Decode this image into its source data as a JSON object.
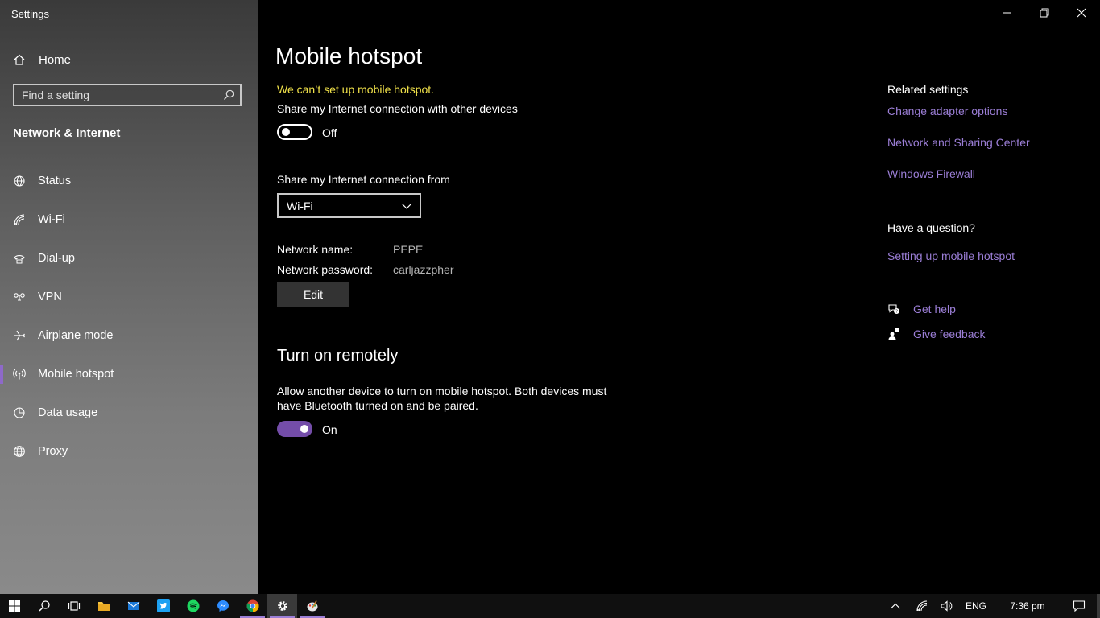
{
  "window": {
    "title": "Settings"
  },
  "sidebar": {
    "home_label": "Home",
    "search_placeholder": "Find a setting",
    "section_title": "Network & Internet",
    "items": [
      {
        "label": "Status",
        "icon": "globe-status-icon"
      },
      {
        "label": "Wi-Fi",
        "icon": "wifi-icon"
      },
      {
        "label": "Dial-up",
        "icon": "dialup-icon"
      },
      {
        "label": "VPN",
        "icon": "vpn-icon"
      },
      {
        "label": "Airplane mode",
        "icon": "airplane-icon"
      },
      {
        "label": "Mobile hotspot",
        "icon": "hotspot-icon",
        "active": true
      },
      {
        "label": "Data usage",
        "icon": "data-usage-icon"
      },
      {
        "label": "Proxy",
        "icon": "globe-icon"
      }
    ]
  },
  "main": {
    "title": "Mobile hotspot",
    "warning": "We can’t set up mobile hotspot.",
    "share_label": "Share my Internet connection with other devices",
    "share_toggle_state": "Off",
    "share_from_label": "Share my Internet connection from",
    "share_from_value": "Wi-Fi",
    "network_name_key": "Network name:",
    "network_name_value": "PEPE",
    "network_password_key": "Network password:",
    "network_password_value": "carljazzpher",
    "edit_label": "Edit",
    "remote_title": "Turn on remotely",
    "remote_desc": "Allow another device to turn on mobile hotspot. Both devices must have Bluetooth turned on and be paired.",
    "remote_toggle_state": "On"
  },
  "related": {
    "heading": "Related settings",
    "links": [
      "Change adapter options",
      "Network and Sharing Center",
      "Windows Firewall"
    ],
    "question_heading": "Have a question?",
    "question_link": "Setting up mobile hotspot",
    "get_help": "Get help",
    "give_feedback": "Give feedback"
  },
  "taskbar": {
    "language": "ENG",
    "time": "7:36 pm"
  },
  "colors": {
    "accent": "#744da9",
    "link": "#9b7ed6",
    "warning": "#f1e24a"
  }
}
